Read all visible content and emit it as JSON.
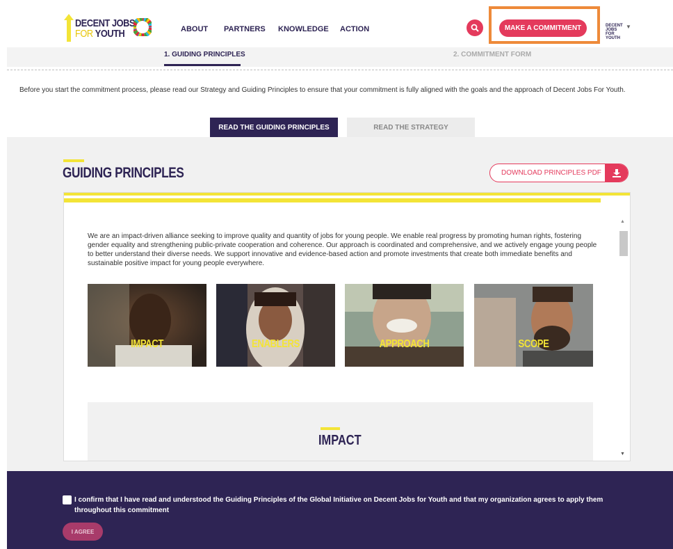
{
  "header": {
    "logo": {
      "line1": "DECENT JOBS",
      "line2_prefix": "FOR",
      "line2_main": "YOUTH"
    },
    "nav": [
      "ABOUT",
      "PARTNERS",
      "KNOWLEDGE",
      "ACTION"
    ],
    "cta_label": "MAKE A COMMITMENT",
    "lang_logo_text": "DECENT JOBS FOR YOUTH",
    "icons": {
      "search": "search-icon",
      "caret": "chevron-down-icon"
    }
  },
  "steps": {
    "step1": "1. GUIDING PRINCIPLES",
    "step2": "2. COMMITMENT FORM"
  },
  "intro": "Before you start the commitment process, please read our Strategy and Guiding Principles to ensure that your commitment is fully aligned with the goals and the approach of Decent Jobs For Youth.",
  "tabs": {
    "active": "READ THE GUIDING PRINCIPLES",
    "inactive": "READ THE STRATEGY"
  },
  "section": {
    "title": "GUIDING PRINCIPLES",
    "download_label": "DOWNLOAD PRINCIPLES PDF",
    "body": "We are an impact-driven alliance seeking to improve quality and quantity of jobs for young people. We enable real progress by promoting human rights, fostering gender equality and strengthening public-private cooperation and coherence. Our approach is coordinated and comprehensive, and we actively engage young people to better understand their diverse needs. We support innovative and evidence-based action and promote investments that create both immediate benefits and sustainable positive impact for young people everywhere.",
    "cards": [
      {
        "label": "IMPACT"
      },
      {
        "label": "ENABLERS"
      },
      {
        "label": "APPROACH"
      },
      {
        "label": "SCOPE"
      }
    ],
    "subsection_title": "IMPACT"
  },
  "footer": {
    "confirm_text": "I confirm that I have read and understood the Guiding Principles of the Global Initiative on Decent Jobs for Youth and that my organization agrees to apply them throughout this commitment",
    "agree_label": "I AGREE"
  },
  "colors": {
    "primary": "#2e2454",
    "accent": "#e43a5c",
    "yellow": "#f3e437",
    "highlight": "#ee8a3a"
  }
}
